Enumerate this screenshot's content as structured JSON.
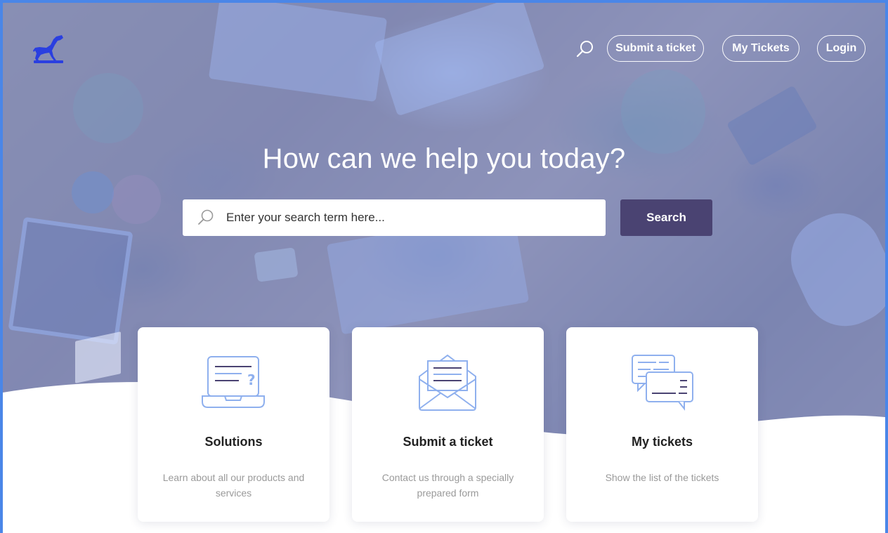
{
  "header": {
    "logo_icon": "greyhound-dog-logo-icon",
    "search_icon": "search-icon",
    "nav": {
      "submit_ticket": "Submit a ticket",
      "my_tickets": "My Tickets",
      "login": "Login"
    }
  },
  "hero": {
    "headline": "How can we help you today?",
    "search": {
      "placeholder": "Enter your search term here...",
      "value": "",
      "button_label": "Search"
    }
  },
  "cards": [
    {
      "icon": "laptop-question-icon",
      "title": "Solutions",
      "description": "Learn about all our products and services"
    },
    {
      "icon": "open-envelope-icon",
      "title": "Submit a ticket",
      "description": "Contact us through a specially prepared form"
    },
    {
      "icon": "chat-bubbles-icon",
      "title": "My tickets",
      "description": "Show the list of the tickets"
    }
  ],
  "colors": {
    "frame_border": "#4a86e8",
    "hero_tint": "#7c9cec",
    "search_button": "#4a4372",
    "icon_stroke": "#8fb0ee",
    "icon_accent": "#4a4372",
    "logo": "#2a3fe0"
  }
}
